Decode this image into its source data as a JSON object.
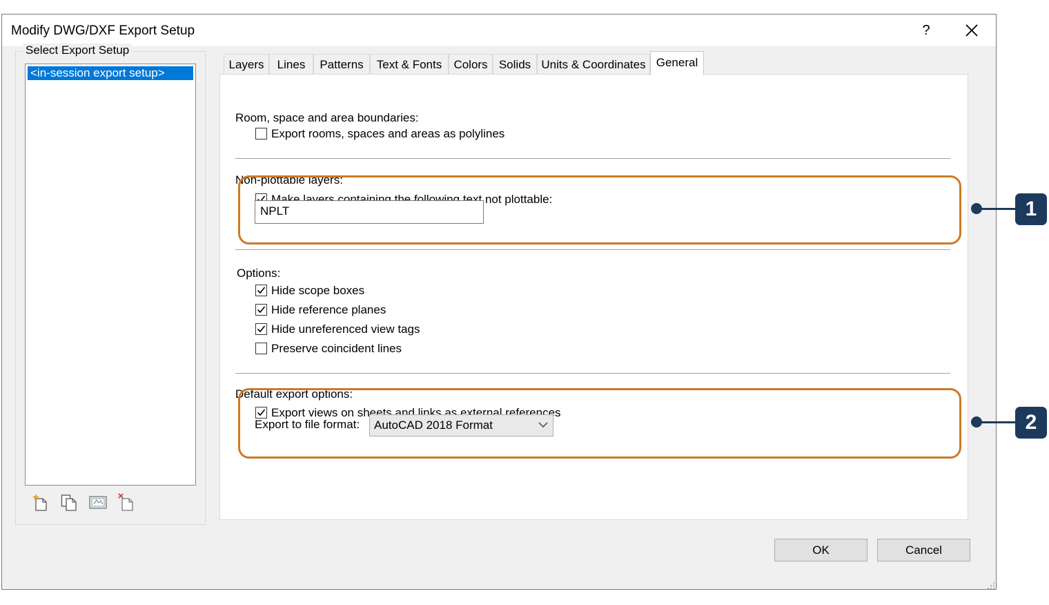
{
  "window": {
    "title": "Modify DWG/DXF Export Setup",
    "help": "?"
  },
  "left": {
    "group_label": "Select Export Setup",
    "items": [
      "<in-session export setup>"
    ],
    "toolbar_icons": [
      "new-setup-icon",
      "duplicate-setup-icon",
      "rename-setup-icon",
      "delete-setup-icon"
    ]
  },
  "tabs": [
    {
      "label": "Layers",
      "active": false
    },
    {
      "label": "Lines",
      "active": false
    },
    {
      "label": "Patterns",
      "active": false
    },
    {
      "label": "Text & Fonts",
      "active": false
    },
    {
      "label": "Colors",
      "active": false
    },
    {
      "label": "Solids",
      "active": false
    },
    {
      "label": "Units & Coordinates",
      "active": false
    },
    {
      "label": "General",
      "active": true
    }
  ],
  "general": {
    "room_label": "Room, space and area boundaries:",
    "room_checkbox": {
      "label": "Export rooms, spaces and areas as polylines",
      "checked": false
    },
    "nonplot_label": "Non-plottable layers:",
    "nonplot_checkbox": {
      "label": "Make layers containing the following text not plottable:",
      "checked": true
    },
    "nonplot_value": "NPLT",
    "options_label": "Options:",
    "options": [
      {
        "label": "Hide scope boxes",
        "checked": true
      },
      {
        "label": "Hide reference planes",
        "checked": true
      },
      {
        "label": "Hide unreferenced view tags",
        "checked": true
      },
      {
        "label": "Preserve coincident lines",
        "checked": false
      }
    ],
    "default_label": "Default export options:",
    "default_checkbox": {
      "label": "Export views on sheets and links as external references",
      "checked": true
    },
    "format_label": "Export to file format:",
    "format_value": "AutoCAD 2018 Format"
  },
  "buttons": {
    "ok": "OK",
    "cancel": "Cancel"
  },
  "callouts": [
    "1",
    "2"
  ],
  "colors": {
    "highlight": "#cc7a24",
    "callout": "#1d3a5c",
    "selection": "#0078d7"
  }
}
